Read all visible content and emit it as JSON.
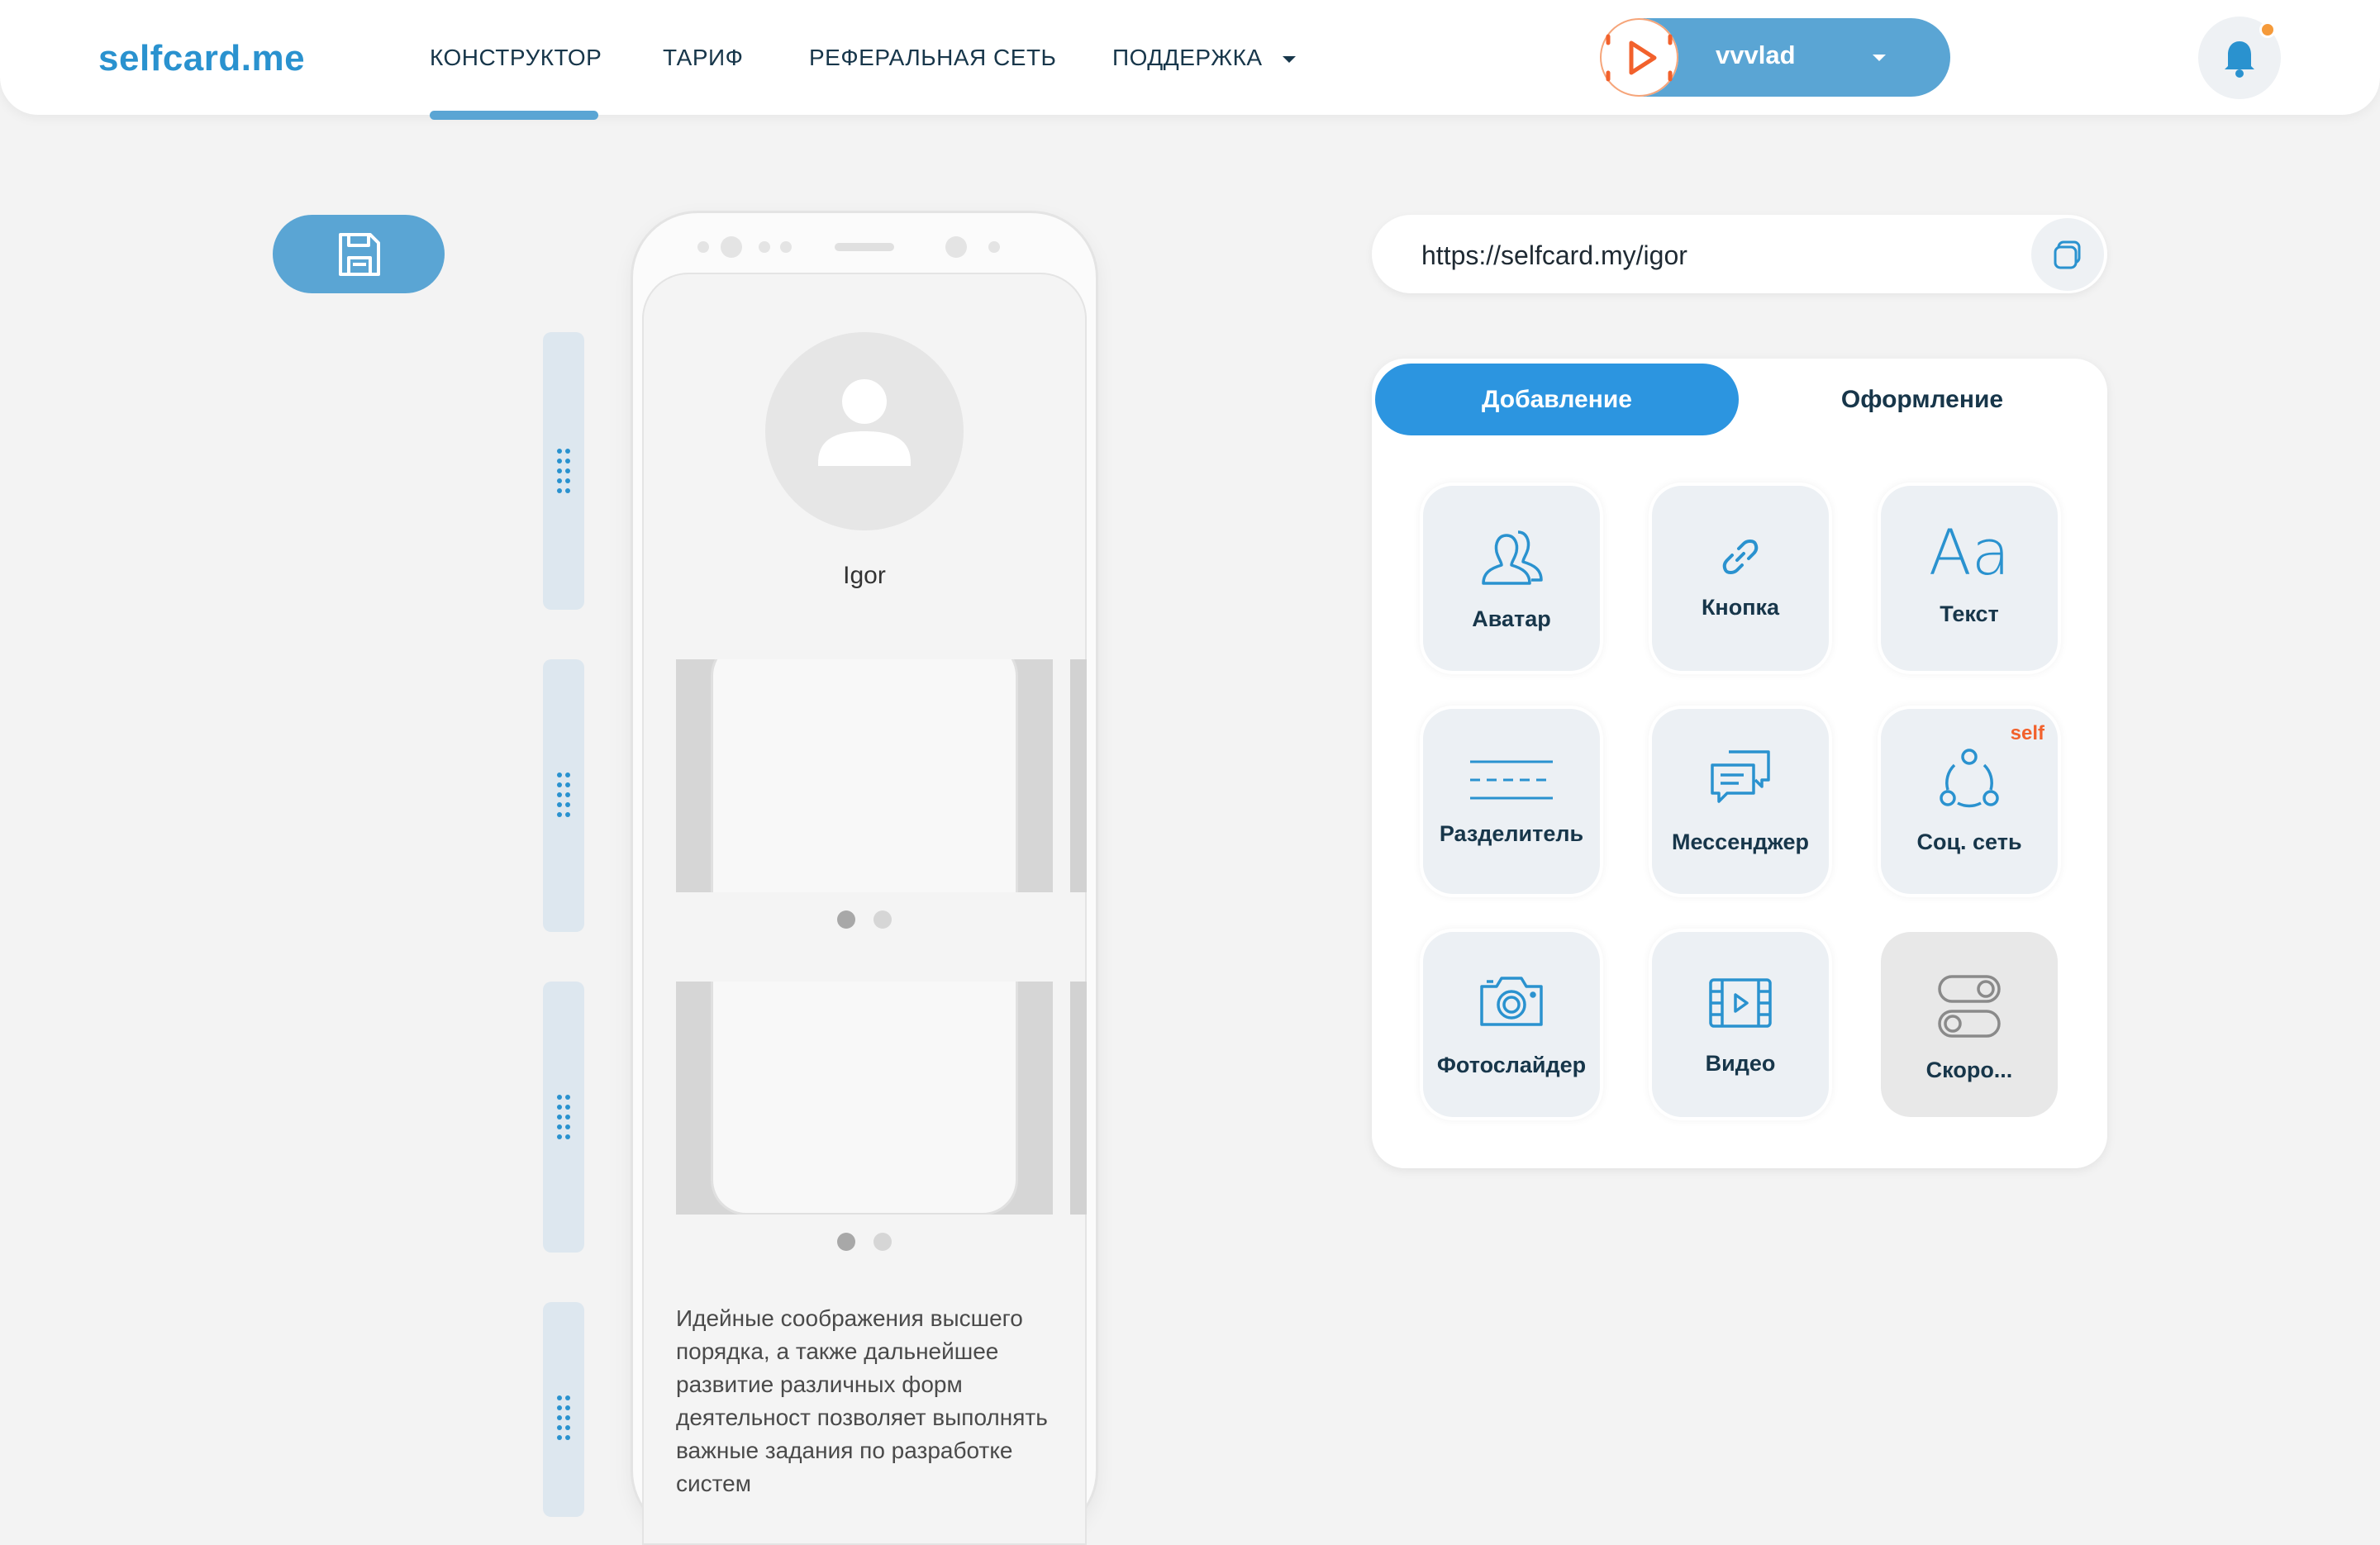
{
  "header": {
    "logo": "selfcard.me",
    "nav": [
      {
        "label": "КОНСТРУКТОР",
        "active": true
      },
      {
        "label": "ТАРИФ"
      },
      {
        "label": "РЕФЕРАЛЬНАЯ СЕТЬ"
      },
      {
        "label": "ПОДДЕРЖКА",
        "has_dropdown": true
      }
    ],
    "user": {
      "name": "vvvlad",
      "avatar_icon": "play-logo-icon"
    },
    "notifications": {
      "icon": "bell-icon",
      "has_unread": true
    }
  },
  "toolbar": {
    "save_icon": "floppy-disk-icon"
  },
  "preview": {
    "profile_name": "Igor",
    "body_text": "Идейные соображения высшего порядка, а также дальнейшее развитие различных форм деятельност позволяет выполнять важные задания по разработке систем",
    "slider_1": {
      "total": 2,
      "current": 1
    },
    "slider_2": {
      "total": 2,
      "current": 1
    }
  },
  "url": {
    "value": "https://selfcard.my/igor",
    "copy_icon": "copy-icon"
  },
  "panel": {
    "tabs": [
      {
        "label": "Добавление",
        "active": true
      },
      {
        "label": "Оформление",
        "active": false
      }
    ],
    "tiles": [
      {
        "label": "Аватар",
        "icon": "users-icon"
      },
      {
        "label": "Кнопка",
        "icon": "link-icon"
      },
      {
        "label": "Текст",
        "icon": "text-aa-icon",
        "icon_text": "Aa"
      },
      {
        "label": "Разделитель",
        "icon": "divider-icon"
      },
      {
        "label": "Мессенджер",
        "icon": "chat-icon"
      },
      {
        "label": "Соц. сеть",
        "icon": "share-network-icon",
        "badge": "self"
      },
      {
        "label": "Фотослайдер",
        "icon": "camera-icon"
      },
      {
        "label": "Видео",
        "icon": "video-icon"
      },
      {
        "label": "Скоро...",
        "icon": "toggle-icon",
        "disabled": true
      }
    ]
  },
  "colors": {
    "brand": "#2a92cf",
    "accent_pill": "#5aa5d4",
    "tab_active": "#2c95e0",
    "badge": "#f2612c",
    "notification_dot": "#f59a3a"
  }
}
